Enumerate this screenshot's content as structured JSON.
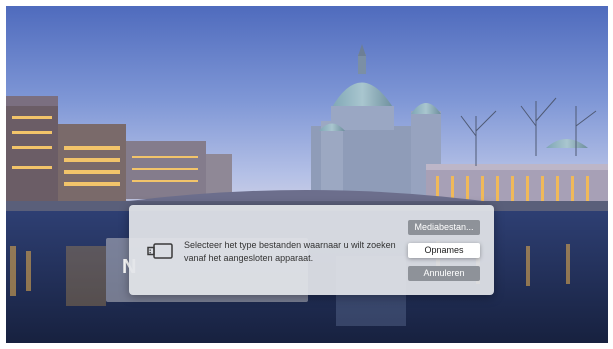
{
  "background": {
    "card_text": "N"
  },
  "dialog": {
    "icon": "usb-device-icon",
    "message": "Selecteer het type bestanden waarnaar u wilt zoeken vanaf het aangesloten apparaat.",
    "buttons": {
      "media": "Mediabestan...",
      "recordings": "Opnames",
      "cancel": "Annuleren"
    }
  },
  "colors": {
    "dialog_bg": "#e2e4e8",
    "button_gray": "#8e9299",
    "button_focused": "#ffffff"
  }
}
